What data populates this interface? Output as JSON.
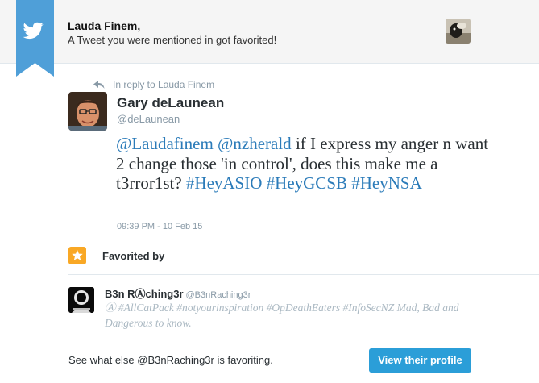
{
  "header": {
    "title": "Lauda Finem,",
    "subtitle": "A Tweet you were mentioned in got favorited!"
  },
  "tweet": {
    "reply_to": "In reply to Lauda Finem",
    "author_name": "Gary deLaunean",
    "author_handle": "@deLaunean",
    "text_parts": [
      "@Laudafinem",
      " ",
      "@nzherald",
      " if I express my anger n want 2 change those 'in control', does this make me a t3rror1st? ",
      "#HeyASIO",
      " ",
      "#HeyGCSB",
      " ",
      "#HeyNSA"
    ],
    "timestamp": "09:39 PM - 10 Feb 15"
  },
  "favorited": {
    "label": "Favorited by",
    "name": "B3n RⒶching3r",
    "handle": "@B3nRaching3r",
    "bio": "Ⓐ #AllCatPack #notyourinspiration #OpDeathEaters #InfoSecNZ Mad, Bad and Dangerous to know."
  },
  "footer": {
    "text": "See what else @B3nRaching3r is favoriting.",
    "button_label": "View their profile"
  },
  "colors": {
    "link": "#2b7bb9",
    "ribbon": "#4f9fd8",
    "star_badge": "#f9a825",
    "button": "#2b9ed8"
  },
  "icons": {
    "ribbon": "twitter-bird-icon",
    "reply": "reply-arrow-icon",
    "favorite": "star-icon"
  }
}
